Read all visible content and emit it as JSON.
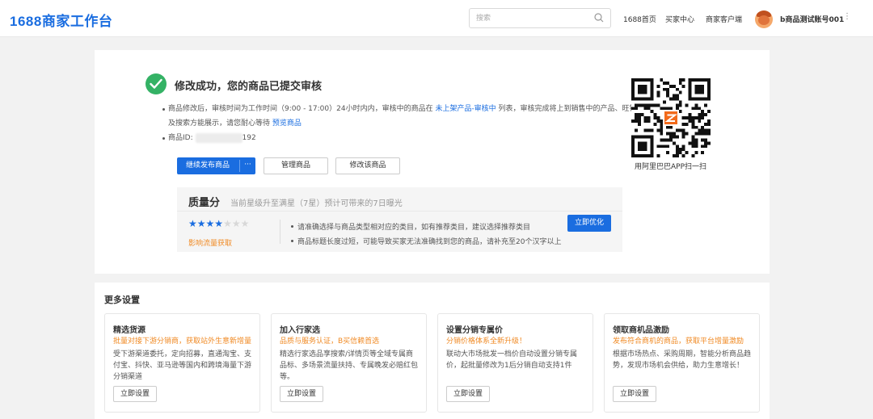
{
  "header": {
    "logo": "1688商家工作台",
    "search_placeholder": "搜索",
    "nav": [
      "1688首页",
      "买家中心",
      "商家客户端"
    ],
    "account": "b商品测试账号001",
    "more": "⋮"
  },
  "result": {
    "title": "修改成功，您的商品已提交审核",
    "line1_a": "商品修改后，审核时间为工作时间（9:00 - 17:00）24小时内内，审核中的商品在 ",
    "line1_link1": "未上架产品-审核中",
    "line1_b": " 列表，审核完成将上到销售中的产品、旺铺以及搜索方能展示，请您耐心等待 ",
    "line1_link2": "预览商品",
    "product_id_label": "商品ID:",
    "product_id_suffix": "192",
    "buttons": {
      "continue": "继续发布商品",
      "more": "···",
      "manage": "管理商品",
      "edit": "修改该商品"
    },
    "qr_caption": "用阿里巴巴APP扫一扫"
  },
  "quality": {
    "title": "质量分",
    "subtitle": "当前星级升至满星（7星）预计可带来的7日曝光",
    "stars_filled": 4,
    "stars_total": 7,
    "tip": "影响流量获取",
    "items": [
      "请准确选择与商品类型相对应的类目，如有推荐类目，建议选择推荐类目",
      "商品标题长度过短，可能导致买家无法准确找到您的商品，请补充至20个汉字以上"
    ],
    "optimize": "立即优化"
  },
  "more_settings": {
    "title": "更多设置",
    "tiles": [
      {
        "title": "精选货源",
        "subtitle": "批量对接下游分销商，获取站外生意新增量",
        "desc": "受下游渠道委托，定向招募，直通淘宝、支付宝、抖快、亚马逊等国内和跨境海量下游分销渠道",
        "button": "立即设置"
      },
      {
        "title": "加入行家选",
        "subtitle": "品质与服务认证，B买信赖首选",
        "desc": "精选行家选品享搜索/详情页等全域专属商品标、多场景流量扶持、专属晚发必赔红包等。",
        "button": "立即设置"
      },
      {
        "title": "设置分销专属价",
        "subtitle": "分销价格体系全新升级！",
        "desc": "联动大市场批发一档价自动设置分销专属价，起批量修改为1后分销自动支持1件",
        "button": "立即设置"
      },
      {
        "title": "领取商机品激励",
        "subtitle": "发布符合商机的商品，获取平台增量激励",
        "desc": "根据市场热点、采购周期，智能分析商品趋势，发现市场机会供给，助力生意增长！",
        "button": "立即设置"
      }
    ]
  },
  "colors": {
    "brand": "#1a6de0",
    "success": "#34b265",
    "warning": "#f08a24"
  }
}
